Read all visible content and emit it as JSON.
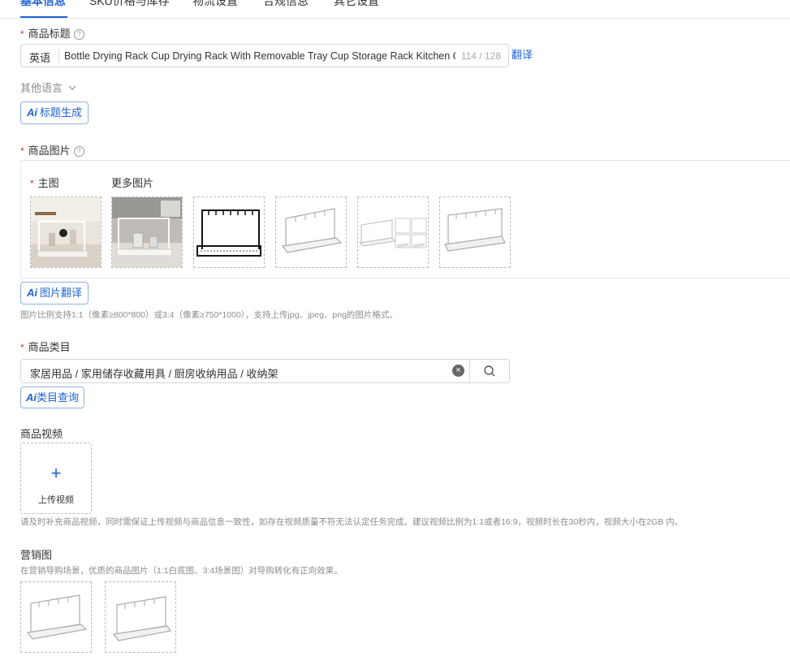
{
  "tabs": [
    "基本信息",
    "SKU价格与库存",
    "物流设置",
    "合规信息",
    "其它设置"
  ],
  "title_section": {
    "label": "商品标题",
    "language": "英语",
    "value": "Bottle Drying Rack Cup Drying Rack With Removable Tray Cup Storage Rack Kitchen Or",
    "count": "114 / 128",
    "translate_link": "翻译",
    "other_languages": "其他语言",
    "ai_button": "标题生成"
  },
  "image_section": {
    "label": "商品图片",
    "main_label": "主图",
    "more_label": "更多图片",
    "ai_button": "图片翻译",
    "hint": "图片比例支持1:1（像素≥800*800）或3:4（像素≥750*1000），支持上传jpg、jpeg、png的图片格式。"
  },
  "category_section": {
    "label": "商品类目",
    "value": "家居用品 / 家用储存收藏用具 / 厨房收纳用品 / 收纳架",
    "ai_button": "类目查询"
  },
  "video_section": {
    "label": "商品视频",
    "upload_label": "上传视频",
    "hint": "请及时补充商品视频，同时需保证上传视频与商品信息一致性，如存在视频质量不符无法认定任务完成。建议视频比例为1:1或者16:9，视频时长在30秒内，视频大小在2GB 内。"
  },
  "marketing_section": {
    "label": "营销图",
    "hint": "在营销导购场景，优质的商品图片（1:1白底图、3:4场景图）对导购转化有正向效果。"
  },
  "ai_prefix": "Ai",
  "required_mark": "*",
  "help_mark": "?",
  "clear_icon": "×",
  "plus_icon": "+",
  "colors": {
    "accent": "#1e63d6",
    "required": "#e5341f",
    "hint": "#8c8c8c",
    "border": "#d6d6d6"
  }
}
